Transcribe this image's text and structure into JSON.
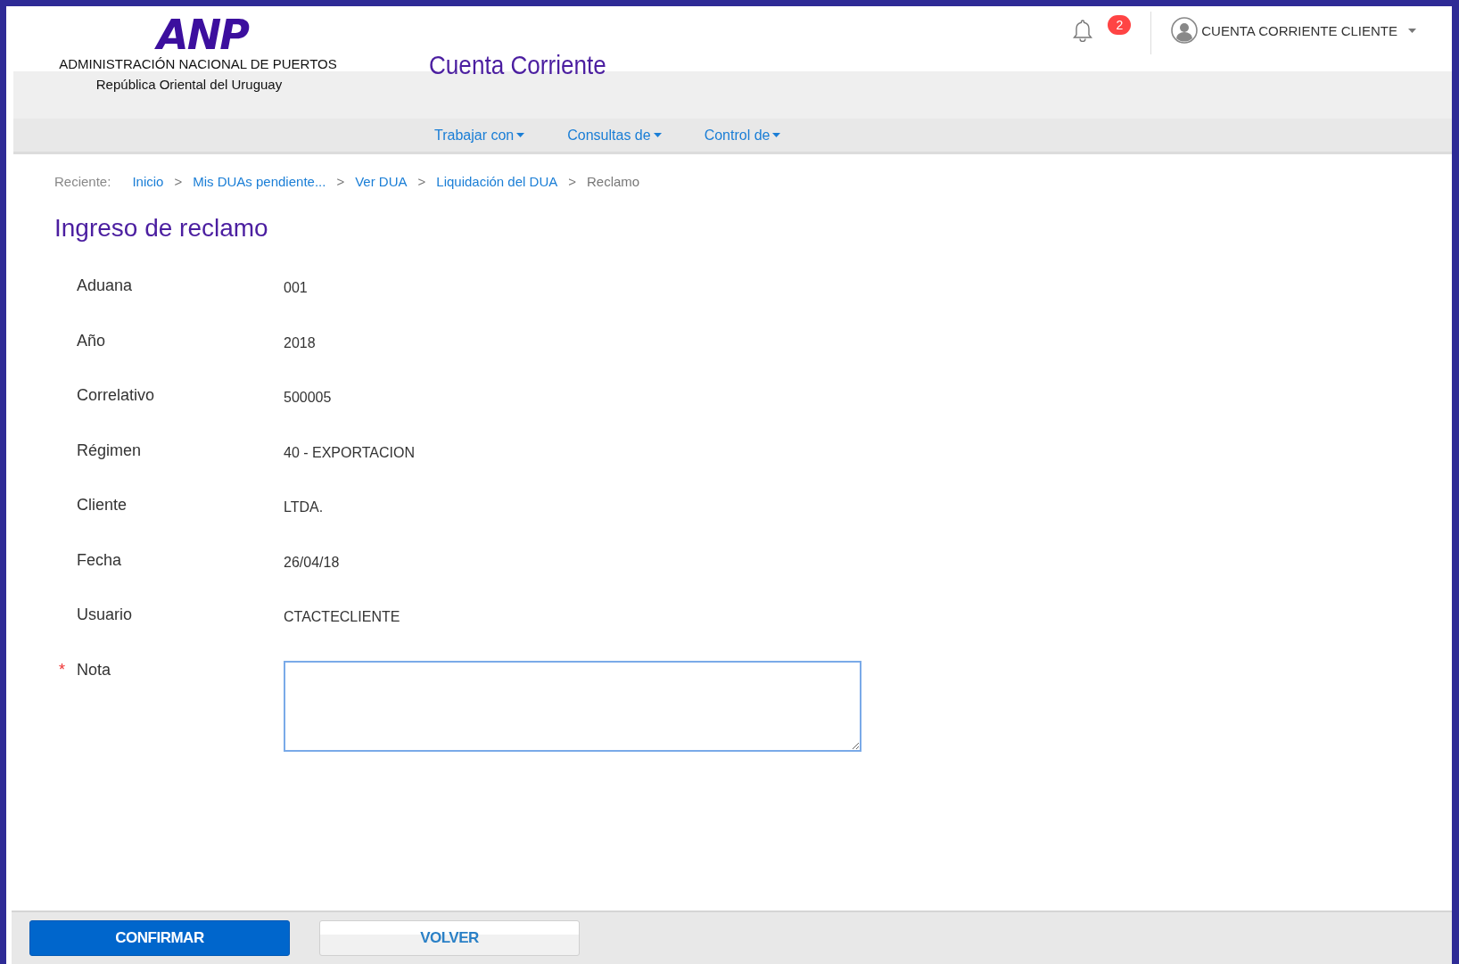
{
  "header": {
    "logo": "ANP",
    "org_name": "ADMINISTRACIÓN NACIONAL DE PUERTOS",
    "org_country": "República Oriental del Uruguay",
    "app_title": "Cuenta Corriente",
    "notifications": "2",
    "user": "CUENTA CORRIENTE CLIENTE"
  },
  "nav": [
    "Trabajar con",
    "Consultas de",
    "Control de"
  ],
  "breadcrumb": {
    "label": "Reciente:",
    "items": [
      {
        "text": "Inicio",
        "link": true
      },
      {
        "separator": ">",
        "text": "Mis DUAs pendiente...",
        "link": true
      },
      {
        "separator": ">",
        "text": "Ver DUA",
        "link": true
      },
      {
        "separator": ">",
        "text": "Liquidación del DUA",
        "link": true
      },
      {
        "separator": ">",
        "text": "Reclamo",
        "link": false
      }
    ]
  },
  "heading": "Ingreso de reclamo",
  "fields": [
    {
      "label": "Aduana",
      "value": "001"
    },
    {
      "label": "Año",
      "value": "2018"
    },
    {
      "label": "Correlativo",
      "value": "500005"
    },
    {
      "label": "Régimen",
      "value": "40 - EXPORTACION"
    },
    {
      "label": "Cliente",
      "value": "LTDA."
    },
    {
      "label": "Fecha",
      "value": "26/04/18"
    },
    {
      "label": "Usuario",
      "value": "CTACTECLIENTE"
    }
  ],
  "note": {
    "label": "Nota",
    "required": true,
    "required_mark": "*"
  },
  "buttons": [
    {
      "label": "CONFIRMAR",
      "kind": "primary"
    },
    {
      "label": "VOLVER",
      "kind": "secondary"
    }
  ]
}
